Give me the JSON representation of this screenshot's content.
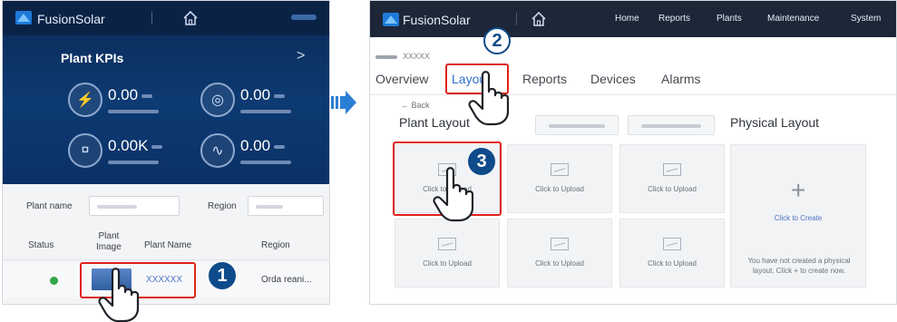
{
  "mobile": {
    "app_name": "FusionSolar",
    "kpi_title": "Plant KPIs",
    "kpi_arrow": ">",
    "kpis": [
      {
        "value": "0.00",
        "icon": "lightning-icon"
      },
      {
        "value": "0.00",
        "icon": "meter-icon"
      },
      {
        "value": "0.00K",
        "icon": "coin-icon"
      },
      {
        "value": "0.00",
        "icon": "chart-icon"
      }
    ],
    "filter": {
      "plant_name_label": "Plant name",
      "region_label": "Region"
    },
    "table": {
      "headers": {
        "status": "Status",
        "plant_image": "Plant\nImage",
        "plant_name": "Plant Name",
        "region": "Region"
      },
      "row": {
        "plant_name": "XXXXXX",
        "region": "Orda reani...",
        "status_color": "#35a54a"
      }
    }
  },
  "desktop": {
    "app_name": "FusionSolar",
    "nav": [
      "Home",
      "Reports",
      "Plants",
      "Maintenance",
      "System"
    ],
    "breadcrumb": "XXXXX",
    "tabs": [
      "Overview",
      "Layout",
      "Reports",
      "Devices",
      "Alarms"
    ],
    "active_tab": "Layout",
    "back_label": "Back",
    "plant_layout_title": "Plant Layout",
    "physical_layout_title": "Physical Layout",
    "upload_label": "Click to Upload",
    "create_label": "Click to Create",
    "physical_note": "You have not created a physical layout. Click + to create now."
  },
  "steps": [
    "1",
    "2",
    "3"
  ],
  "colors": {
    "highlight": "#e0211c",
    "badge": "#0f4a8a",
    "accent": "#2d6ed0",
    "arrow": "#2a7fd4"
  }
}
